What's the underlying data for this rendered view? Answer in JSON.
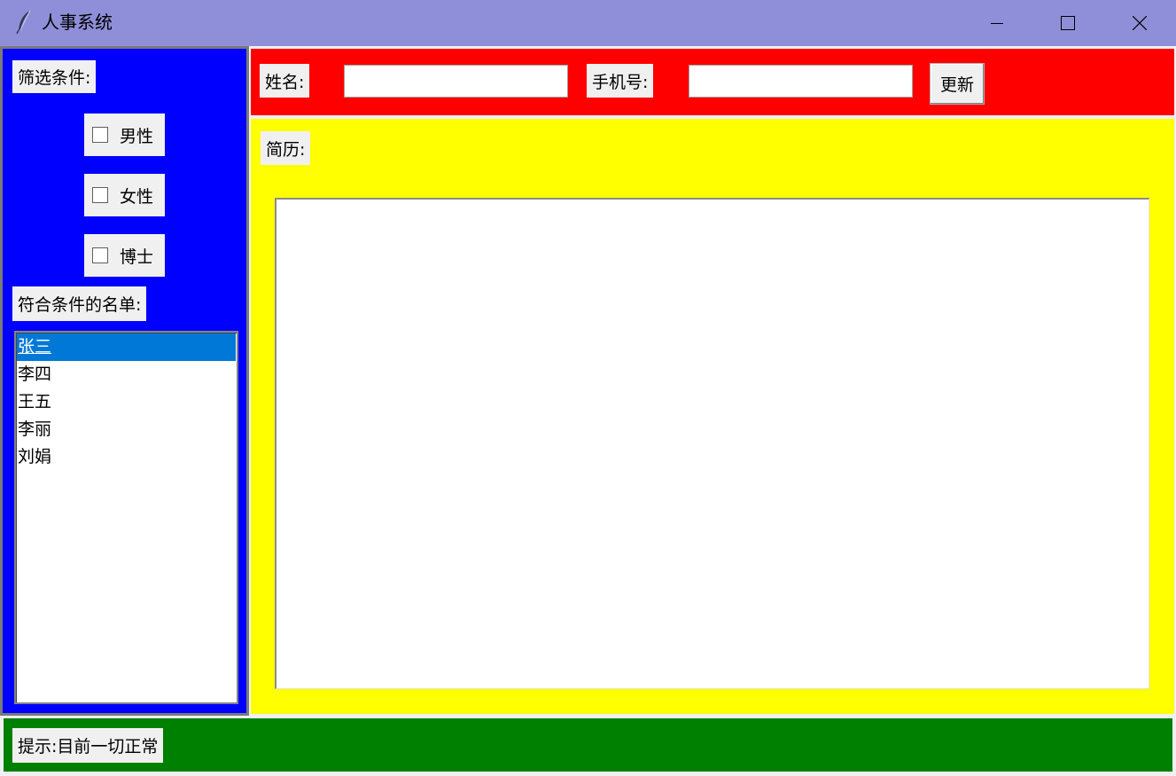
{
  "window": {
    "title": "人事系统",
    "icon": "feather-icon",
    "controls": [
      "minimize-icon",
      "maximize-icon",
      "close-icon"
    ]
  },
  "filter_panel": {
    "label": "筛选条件:",
    "options": [
      {
        "label": "男性",
        "checked": false
      },
      {
        "label": "女性",
        "checked": false
      },
      {
        "label": "博士",
        "checked": false
      }
    ],
    "result_label": "符合条件的名单:",
    "names": [
      "张三",
      "李四",
      "王五",
      "李丽",
      "刘娟"
    ],
    "selected_name": "张三"
  },
  "top_bar": {
    "name_label": "姓名:",
    "name_value": "",
    "phone_label": "手机号:",
    "phone_value": "",
    "update_button": "更新"
  },
  "resume": {
    "label": "简历:",
    "text": ""
  },
  "status": {
    "text": "提示:目前一切正常"
  },
  "colors": {
    "titlebar": "#8f8fd9",
    "filter_panel": "#0000ff",
    "top_bar": "#ff0000",
    "resume_panel": "#ffff00",
    "status_bar": "#008000",
    "selection": "#0078d7"
  }
}
